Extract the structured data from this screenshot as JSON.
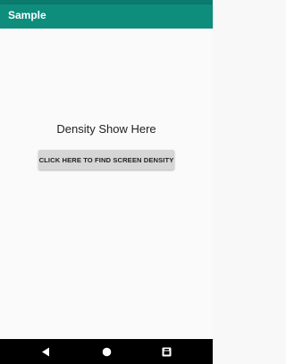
{
  "app_bar": {
    "title": "Sample",
    "color": "#0e8d7d",
    "status_color": "#0a7b6d"
  },
  "main": {
    "density_text": "Density Show Here",
    "button_label": "CLICK HERE TO FIND SCREEN DENSITY"
  },
  "nav_bar": {
    "back_icon": "back-triangle",
    "home_icon": "home-circle",
    "recents_icon": "recents-square"
  }
}
